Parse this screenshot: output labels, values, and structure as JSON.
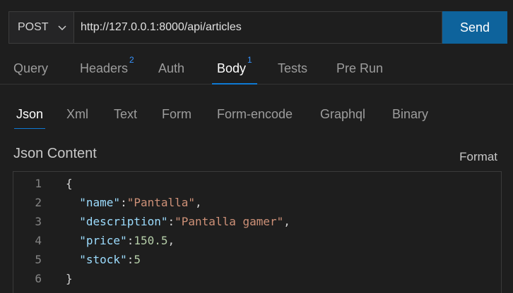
{
  "request": {
    "method": "POST",
    "url": "http://127.0.0.1:8000/api/articles",
    "send_label": "Send"
  },
  "tabs": [
    {
      "label": "Query",
      "badge": ""
    },
    {
      "label": "Headers",
      "badge": "2"
    },
    {
      "label": "Auth",
      "badge": ""
    },
    {
      "label": "Body",
      "badge": "1",
      "active": true
    },
    {
      "label": "Tests",
      "badge": ""
    },
    {
      "label": "Pre Run",
      "badge": ""
    }
  ],
  "body_tabs": [
    {
      "label": "Json",
      "active": true
    },
    {
      "label": "Xml"
    },
    {
      "label": "Text"
    },
    {
      "label": "Form"
    },
    {
      "label": "Form-encode"
    },
    {
      "label": "Graphql"
    },
    {
      "label": "Binary"
    }
  ],
  "content": {
    "title": "Json Content",
    "format_label": "Format"
  },
  "editor": {
    "line_numbers": [
      "1",
      "2",
      "3",
      "4",
      "5",
      "6"
    ],
    "lines": {
      "open": "{",
      "l2_key": "\"name\"",
      "l2_val": "\"Pantalla\"",
      "l3_key": "\"description\"",
      "l3_val": "\"Pantalla gamer\"",
      "l4_key": "\"price\"",
      "l4_val": "150.5",
      "l5_key": "\"stock\"",
      "l5_val": "5",
      "close": "}"
    }
  },
  "colors": {
    "accent": "#0e639c",
    "badge": "#3794ff",
    "json_key": "#9cdcfe",
    "json_string": "#ce9178",
    "json_number": "#b5cea8"
  }
}
